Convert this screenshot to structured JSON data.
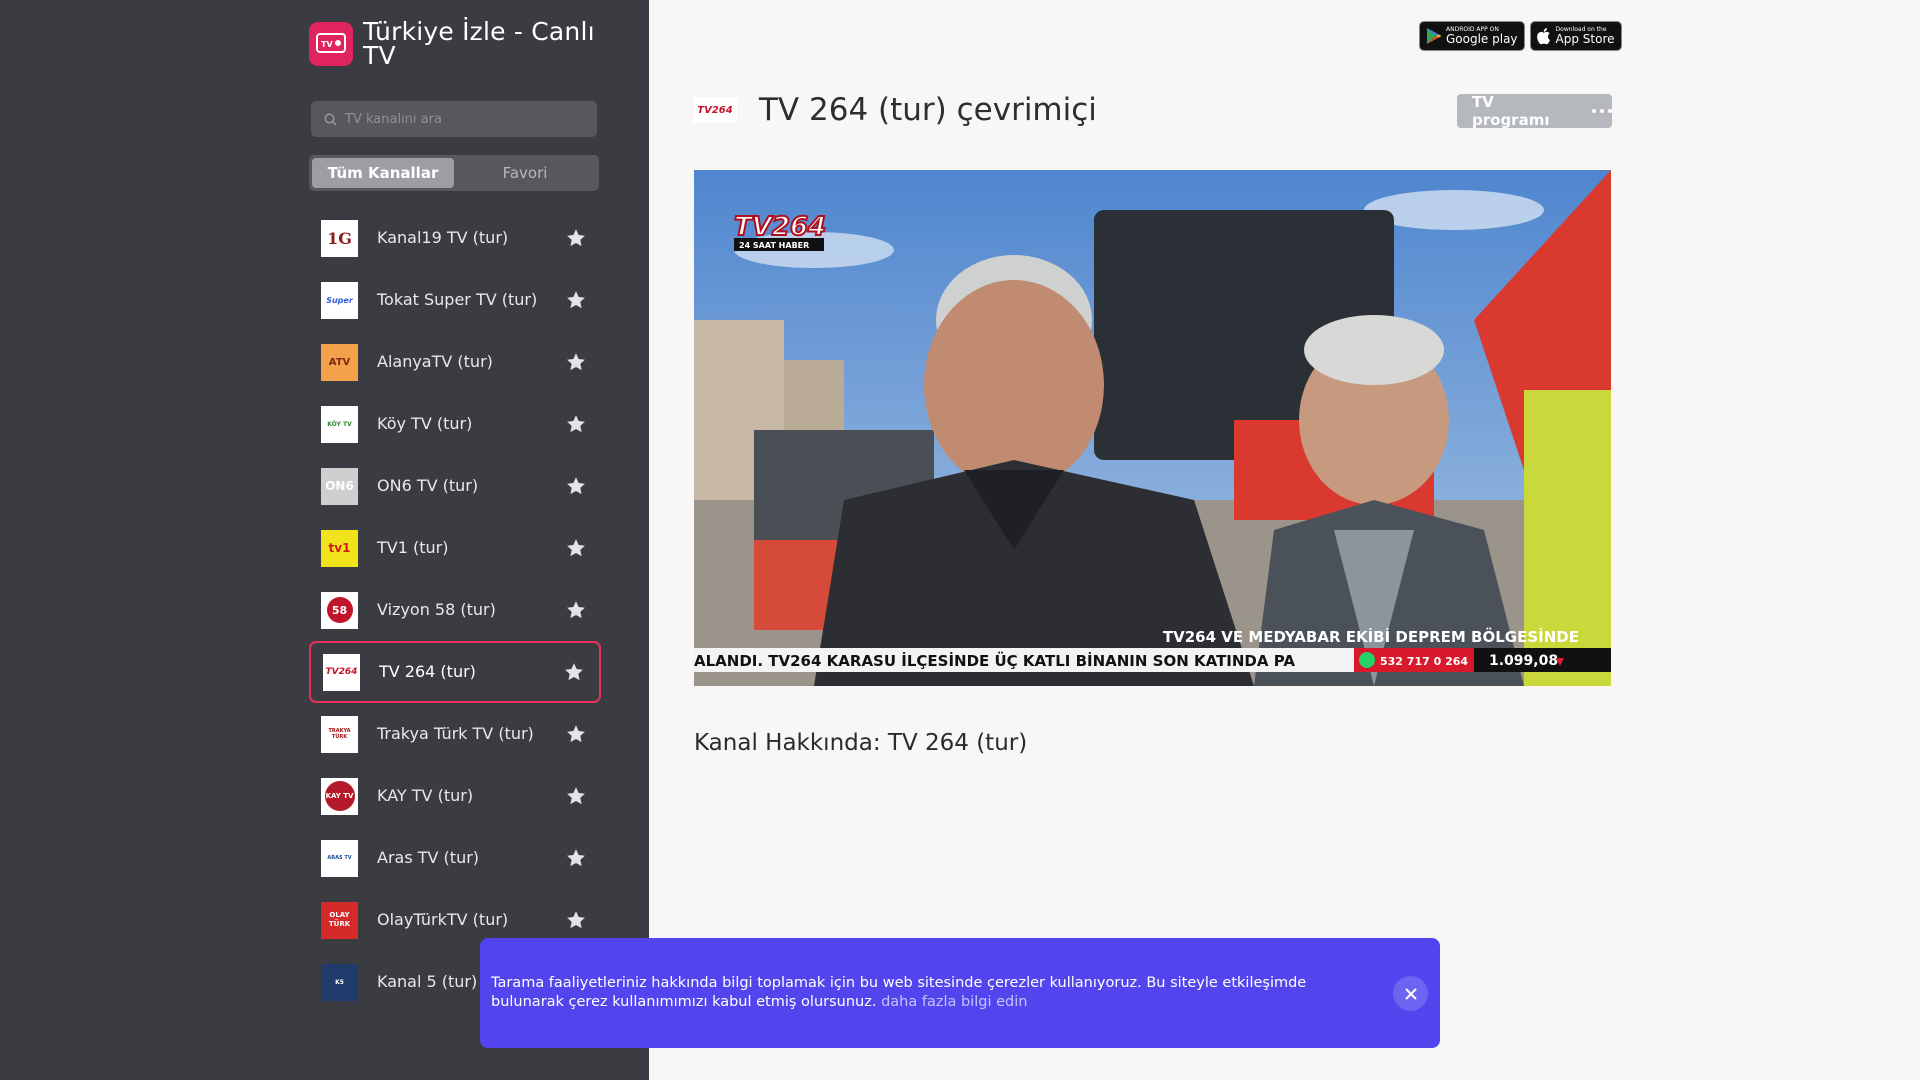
{
  "brand": {
    "title": "Türkiye İzle - Canlı TV",
    "accent": "#e0245e"
  },
  "search": {
    "placeholder": "TV kanalını ara"
  },
  "tabs": [
    {
      "label": "Tüm Kanallar",
      "active": true
    },
    {
      "label": "Favori",
      "active": false
    }
  ],
  "channels": [
    {
      "name": "Kanal19 TV (tur)",
      "logo": "1G"
    },
    {
      "name": "Tokat Super TV (tur)",
      "logo": "Super"
    },
    {
      "name": "AlanyaTV (tur)",
      "logo": "ATV"
    },
    {
      "name": "Köy TV (tur)",
      "logo": "KÖY TV"
    },
    {
      "name": "ON6 TV (tur)",
      "logo": "ON6"
    },
    {
      "name": "TV1 (tur)",
      "logo": "tv1"
    },
    {
      "name": "Vizyon 58 (tur)",
      "logo": "58"
    },
    {
      "name": "TV 264 (tur)",
      "logo": "TV264",
      "active": true
    },
    {
      "name": "Trakya Türk TV (tur)",
      "logo": "TRAKYA TÜRK"
    },
    {
      "name": "KAY TV (tur)",
      "logo": "KAY TV"
    },
    {
      "name": "Aras TV (tur)",
      "logo": "ARAS TV"
    },
    {
      "name": "OlayTürkTV (tur)",
      "logo": "OLAY TÜRK"
    },
    {
      "name": "Kanal 5 (tur)",
      "logo": "K5"
    }
  ],
  "store": {
    "google": {
      "small": "ANDROID APP ON",
      "big": "Google play"
    },
    "apple": {
      "small": "Download on the",
      "big": "App Store"
    }
  },
  "main": {
    "title": "TV 264 (tur) çevrimiçi",
    "tv_program_label": "TV programı",
    "about": "Kanal Hakkında: TV 264 (tur)"
  },
  "video": {
    "logo": "TV264",
    "logo_sub": "24 SAAT HABER",
    "headline": "TV264 VE MEDYABAR EKİBİ DEPREM BÖLGESİNDE",
    "ticker": "ALANDI. TV264 KARASU İLÇESİNDE ÜÇ KATLI BİNANIN SON KATINDA PA",
    "phone": "532 717 0 264",
    "price": "1.099,08"
  },
  "cookie": {
    "text": "Tarama faaliyetleriniz hakkında bilgi toplamak için bu web sitesinde çerezler kullanıyoruz. Bu siteyle etkileşimde bulunarak çerez kullanımımızı kabul etmiş olursunuz.",
    "link": "daha fazla bilgi edin"
  }
}
